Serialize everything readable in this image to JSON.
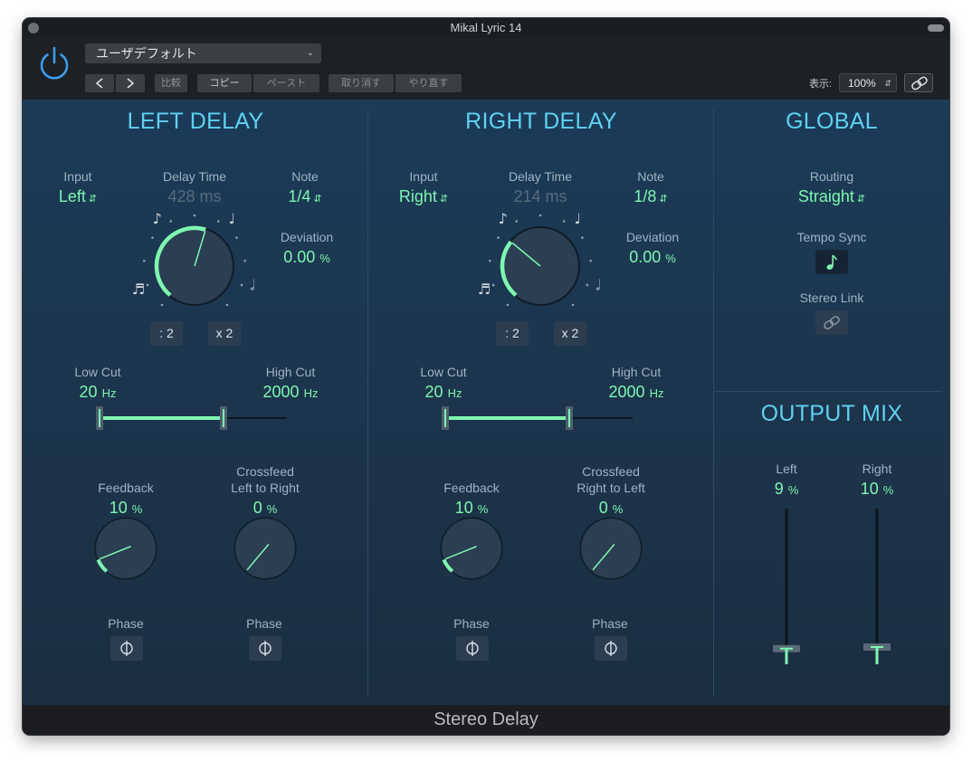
{
  "window": {
    "title": "Mikal Lyric 14",
    "footer": "Stereo Delay"
  },
  "toolbar": {
    "preset": "ユーザデフォルト",
    "compare": "比較",
    "copy": "コピー",
    "paste": "ペースト",
    "undo": "取り消す",
    "redo": "やり直す",
    "view_label": "表示:",
    "zoom": "100%"
  },
  "left_delay": {
    "title": "LEFT DELAY",
    "input_label": "Input",
    "input_value": "Left",
    "delay_time_label": "Delay Time",
    "delay_time_value": "428 ms",
    "note_label": "Note",
    "note_value": "1/4",
    "deviation_label": "Deviation",
    "deviation_value": "0.00",
    "deviation_unit": "%",
    "half_button": ": 2",
    "double_button": "x 2",
    "low_cut_label": "Low Cut",
    "low_cut_value": "20",
    "low_cut_unit": "Hz",
    "high_cut_label": "High Cut",
    "high_cut_value": "2000",
    "high_cut_unit": "Hz",
    "feedback_label": "Feedback",
    "feedback_value": "10",
    "feedback_unit": "%",
    "crossfeed_label_1": "Crossfeed",
    "crossfeed_label_2": "Left to Right",
    "crossfeed_value": "0",
    "crossfeed_unit": "%",
    "phase_label_1": "Phase",
    "phase_label_2": "Phase",
    "delay_knob_fraction": 0.56,
    "feedback_knob_fraction": 0.1,
    "crossfeed_knob_fraction": 0.0
  },
  "right_delay": {
    "title": "RIGHT DELAY",
    "input_label": "Input",
    "input_value": "Right",
    "delay_time_label": "Delay Time",
    "delay_time_value": "214 ms",
    "note_label": "Note",
    "note_value": "1/8",
    "deviation_label": "Deviation",
    "deviation_value": "0.00",
    "deviation_unit": "%",
    "half_button": ": 2",
    "double_button": "x 2",
    "low_cut_label": "Low Cut",
    "low_cut_value": "20",
    "low_cut_unit": "Hz",
    "high_cut_label": "High Cut",
    "high_cut_value": "2000",
    "high_cut_unit": "Hz",
    "feedback_label": "Feedback",
    "feedback_value": "10",
    "feedback_unit": "%",
    "crossfeed_label_1": "Crossfeed",
    "crossfeed_label_2": "Right to Left",
    "crossfeed_value": "0",
    "crossfeed_unit": "%",
    "phase_label_1": "Phase",
    "phase_label_2": "Phase",
    "delay_knob_fraction": 0.32,
    "feedback_knob_fraction": 0.1,
    "crossfeed_knob_fraction": 0.0
  },
  "global": {
    "title": "GLOBAL",
    "routing_label": "Routing",
    "routing_value": "Straight",
    "tempo_sync_label": "Tempo Sync",
    "stereo_link_label": "Stereo Link"
  },
  "output_mix": {
    "title": "OUTPUT MIX",
    "left_label": "Left",
    "left_value": "9",
    "left_unit": "%",
    "right_label": "Right",
    "right_value": "10",
    "right_unit": "%",
    "left_level": 0.09,
    "right_level": 0.1
  },
  "colors": {
    "accent_green": "#7ef7b0",
    "title_cyan": "#5fd1f2",
    "label_gray": "#9fb3c4",
    "panel_blue": "#1b3b58",
    "power_blue": "#3b9cf0"
  },
  "icons": [
    "power-icon",
    "chevron-left-icon",
    "chevron-right-icon",
    "link-icon",
    "note-icon",
    "phase-icon"
  ]
}
